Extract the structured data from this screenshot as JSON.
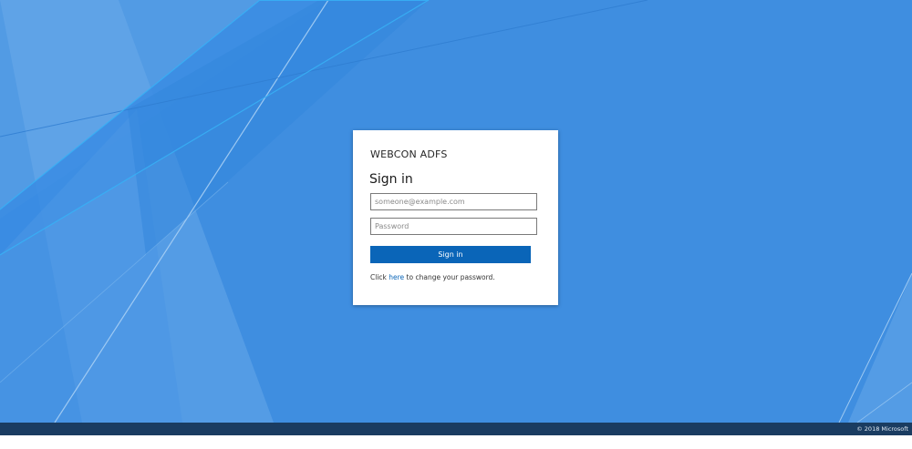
{
  "organization": "WEBCON ADFS",
  "heading": "Sign in",
  "email_field": {
    "placeholder": "someone@example.com",
    "value": ""
  },
  "password_field": {
    "placeholder": "Password",
    "value": ""
  },
  "sign_in_button": "Sign in",
  "password_help": {
    "prefix": "Click ",
    "link": "here",
    "suffix": " to change your password."
  },
  "footer": {
    "copyright": "© 2018 Microsoft"
  },
  "colors": {
    "background": "#3f8ee0",
    "button": "#0a65b8",
    "footer": "#1a3c61"
  }
}
